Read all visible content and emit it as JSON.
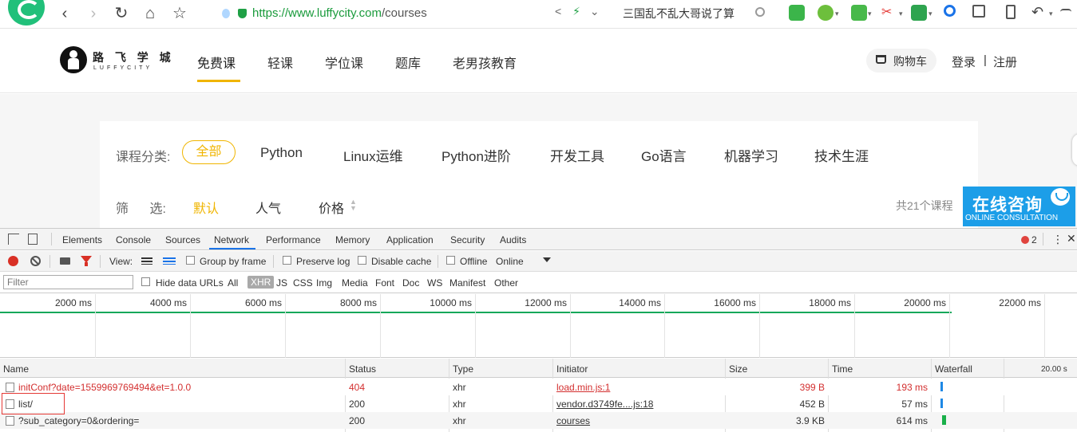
{
  "browser": {
    "url_prefix": "https://www.",
    "url_host": "luffycity.com",
    "url_path": "/courses",
    "search_hint": "三国乱不乱大哥说了算"
  },
  "site": {
    "logo_cn": "路 飞 学 城",
    "logo_en": "LUFFYCITY",
    "nav": [
      "免费课",
      "轻课",
      "学位课",
      "题库",
      "老男孩教育"
    ],
    "cart_label": "购物车",
    "login": "登录",
    "separator": "|",
    "register": "注册"
  },
  "filters": {
    "category_label": "课程分类:",
    "categories": [
      "全部",
      "Python",
      "Linux运维",
      "Python进阶",
      "开发工具",
      "Go语言",
      "机器学习",
      "技术生涯"
    ],
    "sort_label": "筛 选:",
    "sorts": [
      "默认",
      "人气",
      "价格"
    ],
    "total": "共21个课程",
    "consult_cn": "在线咨询",
    "consult_en": "ONLINE CONSULTATION"
  },
  "devtools": {
    "tabs": [
      "Elements",
      "Console",
      "Sources",
      "Network",
      "Performance",
      "Memory",
      "Application",
      "Security",
      "Audits"
    ],
    "active_tab": "Network",
    "error_count": "2",
    "toolbar": {
      "view_label": "View:",
      "group_by_frame": "Group by frame",
      "preserve_log": "Preserve log",
      "disable_cache": "Disable cache",
      "offline": "Offline",
      "throttle": "Online"
    },
    "filter_placeholder": "Filter",
    "hide_data_urls": "Hide data URLs",
    "type_filters": [
      "All",
      "XHR",
      "JS",
      "CSS",
      "Img",
      "Media",
      "Font",
      "Doc",
      "WS",
      "Manifest",
      "Other"
    ],
    "active_type": "XHR",
    "overview_ticks": [
      "2000 ms",
      "4000 ms",
      "6000 ms",
      "8000 ms",
      "10000 ms",
      "12000 ms",
      "14000 ms",
      "16000 ms",
      "18000 ms",
      "20000 ms",
      "22000 ms"
    ],
    "columns": [
      "Name",
      "Status",
      "Type",
      "Initiator",
      "Size",
      "Time",
      "Waterfall"
    ],
    "waterfall_scale": "20.00 s",
    "rows": [
      {
        "name": "initConf?date=1559969769494&et=1.0.0",
        "status": "404",
        "type": "xhr",
        "initiator": "load.min.js:1",
        "size": "399 B",
        "time": "193 ms",
        "error": true,
        "waterfall": {
          "start": 0.0,
          "duration": 0.01
        }
      },
      {
        "name": "list/",
        "status": "200",
        "type": "xhr",
        "initiator": "vendor.d3749fe....js:18",
        "size": "452 B",
        "time": "57 ms",
        "error": false,
        "waterfall": {
          "start": 0.0,
          "duration": 0.01
        }
      },
      {
        "name": "?sub_category=0&ordering=",
        "status": "200",
        "type": "xhr",
        "initiator": "courses",
        "size": "3.9 KB",
        "time": "614 ms",
        "error": false,
        "waterfall": {
          "start": 0.01,
          "duration": 0.02
        }
      }
    ]
  }
}
